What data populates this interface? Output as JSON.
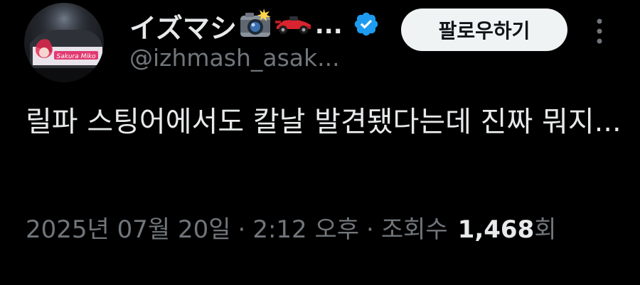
{
  "tweet": {
    "author": {
      "display_name": "イズマシ",
      "name_emojis": [
        "camera-flash-emoji",
        "racing-car-emoji"
      ],
      "name_truncation": "...",
      "handle": "@izhmash_asak...",
      "verified": true,
      "avatar_text": "Sakura Miko"
    },
    "follow_label": "팔로우하기",
    "more_icon": "more-vertical-icon",
    "text": "릴파 스팅어에서도 칼날 발견됐다는데 진짜 뭐지...",
    "timestamp": {
      "date": "2025년 07월 20일",
      "separator": "·",
      "time": "2:12 오후",
      "views_label_prefix": "조회수",
      "views_count": "1,468",
      "views_suffix": "회"
    }
  },
  "colors": {
    "background": "#000000",
    "primary_text": "#e7e9ea",
    "secondary_text": "#71767b",
    "follow_bg": "#eff3f4",
    "verified_blue": "#1d9bf0"
  }
}
